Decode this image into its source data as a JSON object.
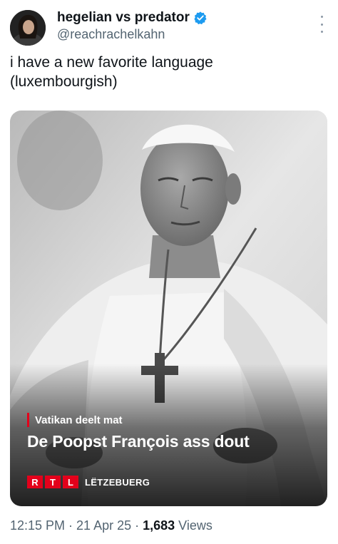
{
  "author": {
    "display_name": "hegelian vs predator",
    "handle": "@reachrachelkahn",
    "verified": true,
    "verified_color": "#1d9bf0",
    "avatar_icon": "profile-photo-avatar"
  },
  "tweet": {
    "text": "i have a new favorite language\n(luxembourgish)"
  },
  "media": {
    "kicker": "Vatikan deelt mat",
    "headline": "De Poopst François ass dout",
    "logo_letters": [
      "R",
      "T",
      "L"
    ],
    "logo_brand": "LËTZEBUERG",
    "accent_color": "#e3001b"
  },
  "meta": {
    "time": "12:15 PM",
    "separator": "·",
    "date": "21 Apr 25",
    "views_count": "1,683",
    "views_label": "Views"
  },
  "icons": {
    "more": "more-options-icon",
    "verified": "verified-badge-icon"
  }
}
